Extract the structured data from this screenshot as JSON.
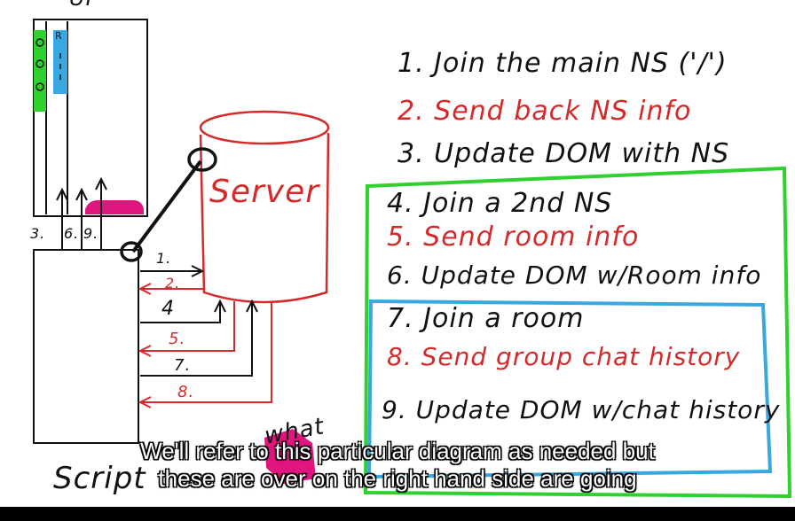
{
  "diagram": {
    "browser_label": "UI",
    "script_label": "Script",
    "server_label": "Server",
    "left_numbers": [
      "3.",
      "6.",
      "9."
    ],
    "arrow_labels": [
      "1.",
      "2.",
      "4",
      "5.",
      "7.",
      "8."
    ],
    "stray_note": "what"
  },
  "steps": [
    {
      "text": "1. Join the main NS ('/')",
      "color": "black"
    },
    {
      "text": "2. Send back NS info",
      "color": "red"
    },
    {
      "text": "3. Update DOM with NS",
      "color": "black"
    },
    {
      "text": "4. Join a 2nd NS",
      "color": "black"
    },
    {
      "text": "5. Send room info",
      "color": "red"
    },
    {
      "text": "6. Update DOM w/Room info",
      "color": "black"
    },
    {
      "text": "7. Join a room",
      "color": "black"
    },
    {
      "text": "8. Send group chat history",
      "color": "red"
    },
    {
      "text": "9. Update DOM w/chat history",
      "color": "black"
    }
  ],
  "subtitle": {
    "line1": "We'll refer to this particular diagram as needed but",
    "line2": "these are over on the right hand side are going"
  },
  "colors": {
    "ink": "#111111",
    "red": "#d42a2a",
    "green": "#2fd12f",
    "blue": "#3aa8e0",
    "magenta": "#e0157e"
  }
}
